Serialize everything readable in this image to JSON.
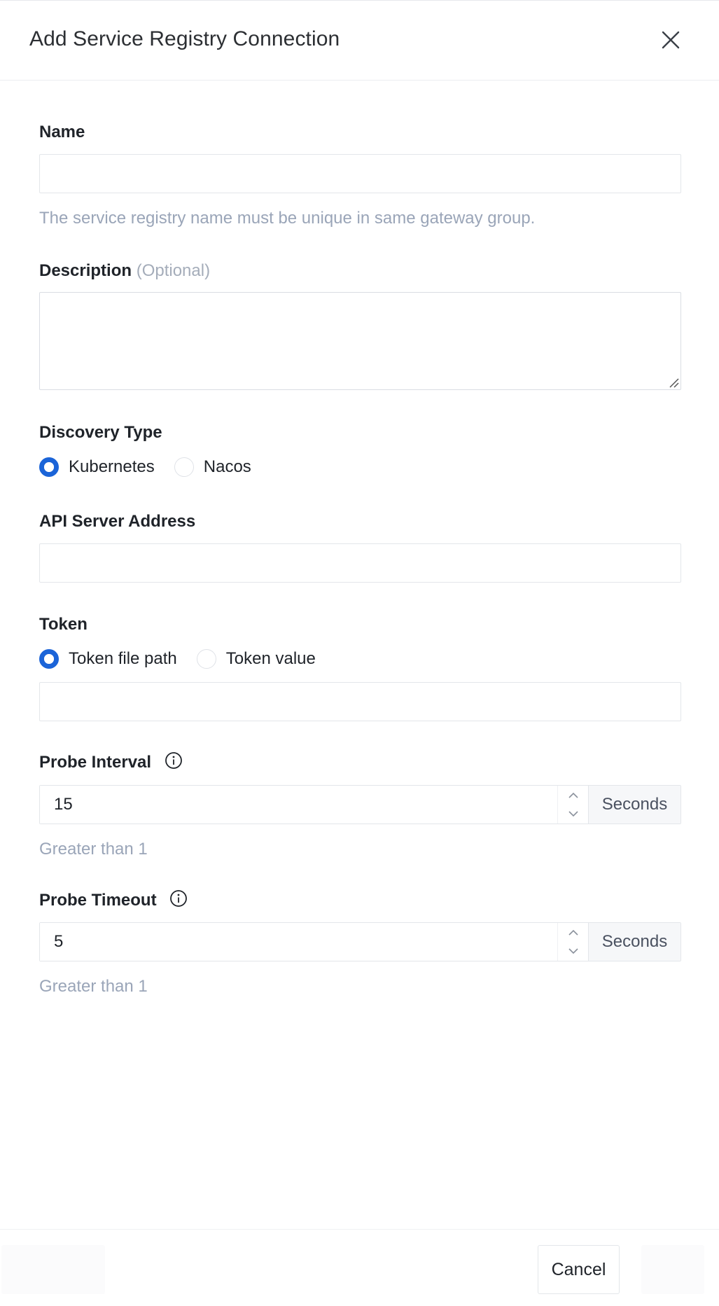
{
  "header": {
    "title": "Add Service Registry Connection",
    "close_icon": "close-icon"
  },
  "form": {
    "name": {
      "label": "Name",
      "value": "",
      "help": "The service registry name must be unique in same gateway group."
    },
    "description": {
      "label": "Description",
      "optional": "(Optional)",
      "value": ""
    },
    "discovery_type": {
      "label": "Discovery Type",
      "options": [
        "Kubernetes",
        "Nacos"
      ],
      "selected": "Kubernetes"
    },
    "api_server": {
      "label": "API Server Address",
      "value": ""
    },
    "token": {
      "label": "Token",
      "options": [
        "Token file path",
        "Token value"
      ],
      "selected": "Token file path",
      "value": ""
    },
    "probe_interval": {
      "label": "Probe Interval",
      "value": "15",
      "unit": "Seconds",
      "help": "Greater than 1"
    },
    "probe_timeout": {
      "label": "Probe Timeout",
      "value": "5",
      "unit": "Seconds",
      "help": "Greater than 1"
    }
  },
  "footer": {
    "cancel_label": "Cancel"
  },
  "colors": {
    "primary": "#1b64d8",
    "help_text": "#9aa5b8",
    "border": "#e3e6ea"
  }
}
